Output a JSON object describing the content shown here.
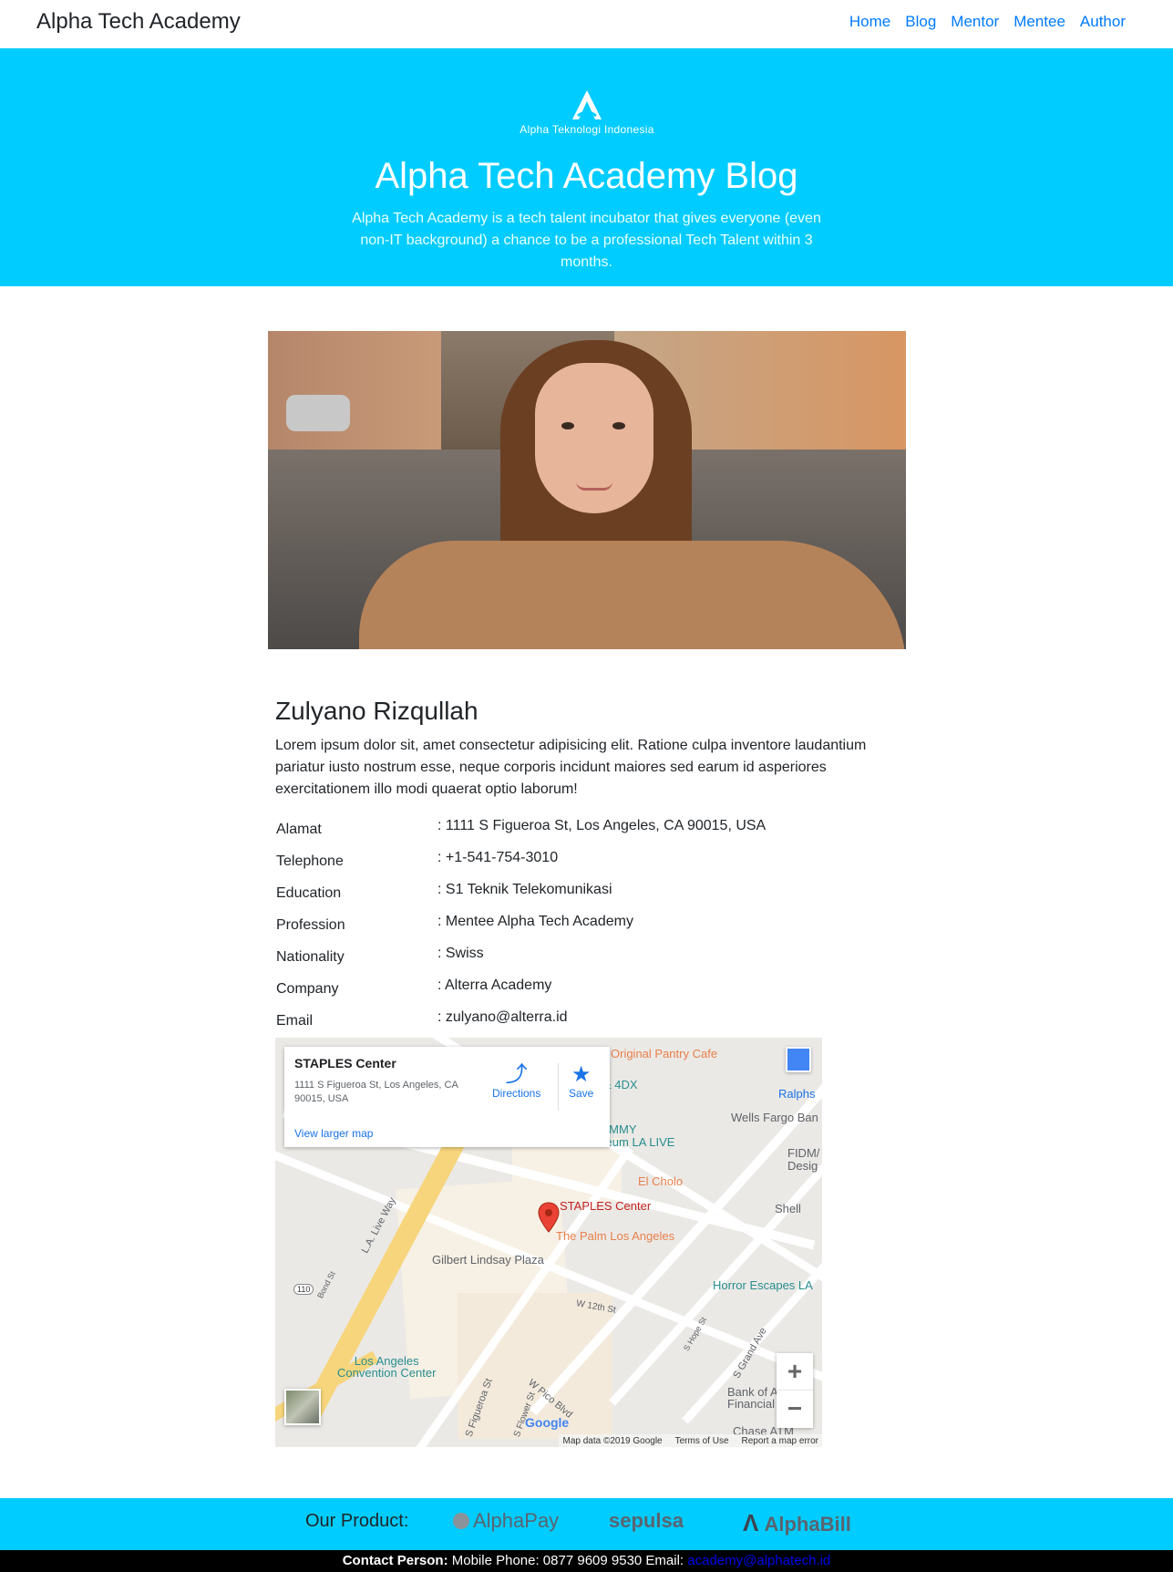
{
  "navbar": {
    "brand": "Alpha Tech Academy",
    "links": [
      "Home",
      "Blog",
      "Mentor",
      "Mentee",
      "Author"
    ]
  },
  "hero": {
    "logo_text": "Alpha Teknologi Indonesia",
    "title": "Alpha Tech Academy Blog",
    "description": "Alpha Tech Academy is a tech talent incubator that gives everyone (even non-IT background) a chance to be a professional Tech Talent within 3 months."
  },
  "profile": {
    "name": "Zulyano Rizqullah",
    "bio": "Lorem ipsum dolor sit, amet consectetur adipisicing elit. Ratione culpa inventore laudantium pariatur iusto nostrum esse, neque corporis incidunt maiores sed earum id asperiores exercitationem illo modi quaerat optio laborum!",
    "info": [
      {
        "label": "Alamat",
        "value": ": 1111 S Figueroa St, Los Angeles, CA 90015, USA"
      },
      {
        "label": "Telephone",
        "value": ": +1-541-754-3010"
      },
      {
        "label": "Education",
        "value": ": S1 Teknik Telekomunikasi"
      },
      {
        "label": "Profession",
        "value": ": Mentee Alpha Tech Academy"
      },
      {
        "label": "Nationality",
        "value": ": Swiss"
      },
      {
        "label": "Company",
        "value": ": Alterra Academy"
      },
      {
        "label": "Email",
        "value": ": zulyano@alterra.id"
      }
    ]
  },
  "map": {
    "card_title": "STAPLES Center",
    "card_address": "1111 S Figueroa St, Los Angeles, CA 90015, USA",
    "directions_label": "Directions",
    "save_label": "Save",
    "view_larger": "View larger map",
    "labels": {
      "original_pantry": "Original Pantry Cafe",
      "ralphs": "Ralphs",
      "wells_fargo": "Wells Fargo Ban",
      "grammy": "GRAMMY\nMuseum LA LIVE",
      "fidm": "FIDM/\nDesig",
      "el_cholo": "El Cholo",
      "staples": "STAPLES Center",
      "shell": "Shell",
      "palm": "The Palm Los Angeles",
      "gilbert": "Gilbert Lindsay Plaza",
      "horror": "Horror Escapes LA",
      "convention": "Los Angeles\nConvention Center",
      "bank": "Bank of A\nFinancial",
      "chase": "Chase ATM",
      "la_live_way": "L.A. Live Way",
      "w12": "W 12th St",
      "pico": "W Pico Blvd",
      "figueroa": "S Figueroa St",
      "grand": "S Grand Ave",
      "hope": "S Hope St",
      "bond": "Bond St",
      "flower": "S Flower St",
      "route110": "110",
      "four_dx": "& 4DX"
    },
    "zoom_in": "+",
    "zoom_out": "−",
    "google": "Google",
    "footer_data": "Map data ©2019 Google",
    "footer_terms": "Terms of Use",
    "footer_report": "Report a map error"
  },
  "products": {
    "label": "Our Product:",
    "items": [
      "AlphaPay",
      "sepulsa",
      "AlphaBill"
    ]
  },
  "contact": {
    "prefix": "Contact Person:",
    "phone": " Mobile Phone: 0877 9609 9530 Email: ",
    "email": "academy@alphatech.id"
  },
  "colors": {
    "accent": "#00ccff",
    "link": "#007bff"
  }
}
